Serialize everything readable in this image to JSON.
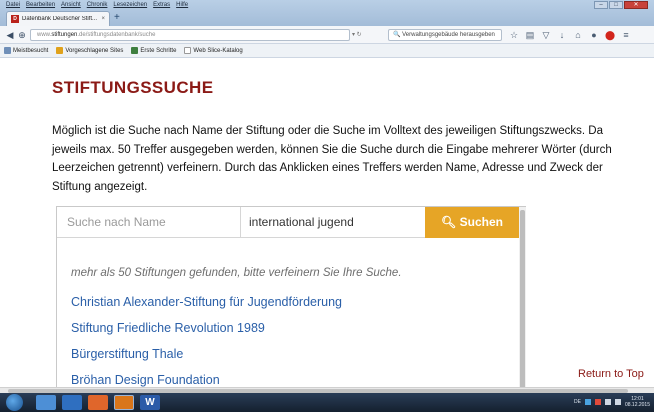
{
  "browser": {
    "menu": [
      "Datei",
      "Bearbeiten",
      "Ansicht",
      "Chronik",
      "Lesezeichen",
      "Extras",
      "Hilfe"
    ],
    "tab_title": "Datenbank Deutscher Stift...",
    "tab_close": "×",
    "new_tab": "+",
    "url_prefix": "www.",
    "url_domain": "stiftungen",
    "url_rest": ".de/stiftungsdatenbank/suche",
    "search_placeholder": "Verwaltungsgebäude herausgeben",
    "bookmarks": [
      "Meistbesucht",
      "Vorgeschlagene Sites",
      "Erste Schritte",
      "Web Slice-Katalog"
    ]
  },
  "page": {
    "title": "STIFTUNGSSUCHE",
    "intro": "Möglich ist die Suche nach Name der Stiftung oder die Suche im Volltext des jeweiligen Stiftungszwecks. Da jeweils max. 50 Treffer ausgegeben werden, können Sie die Suche durch die Eingabe mehrerer Wörter (durch Leerzeichen getrennt) verfeinern. Durch das Anklicken eines Treffers werden Name, Adresse und Zweck der Stiftung angezeigt.",
    "search": {
      "name_placeholder": "Suche nach Name",
      "text_value": "international jugend",
      "button_label": "Suchen"
    },
    "notice": "mehr als 50 Stiftungen gefunden, bitte verfeinern Sie Ihre Suche.",
    "results": [
      "Christian Alexander-Stiftung für Jugendförderung",
      "Stiftung Friedliche Revolution 1989",
      "Bürgerstiftung Thale",
      "Bröhan Design Foundation"
    ],
    "return_top": "Return to Top"
  },
  "taskbar": {
    "lang": "DE",
    "time": "12:01",
    "date": "08.12.2015"
  },
  "colors": {
    "brand_red": "#8b1a16",
    "button_orange": "#e6a526",
    "link_blue": "#2a5fa8"
  }
}
